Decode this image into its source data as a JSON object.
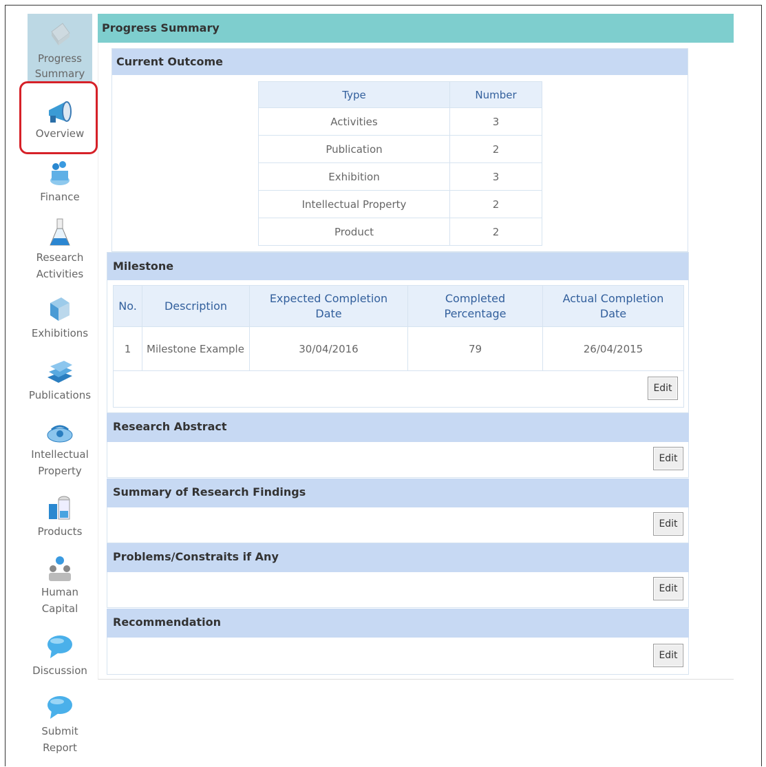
{
  "sidebar": {
    "items": [
      {
        "label": "Progress Summary",
        "icon": "document-icon"
      },
      {
        "label": "Overview",
        "icon": "megaphone-icon"
      },
      {
        "label": "Finance",
        "icon": "money-icon"
      },
      {
        "label": "Research Activities",
        "icon": "flask-icon"
      },
      {
        "label": "Exhibitions",
        "icon": "exhibition-icon"
      },
      {
        "label": "Publications",
        "icon": "books-icon"
      },
      {
        "label": "Intellectual Property",
        "icon": "ip-icon"
      },
      {
        "label": "Products",
        "icon": "products-icon"
      },
      {
        "label": "Human Capital",
        "icon": "people-icon"
      },
      {
        "label": "Discussion",
        "icon": "chat-bubble-icon"
      },
      {
        "label": "Submit Report",
        "icon": "chat-bubble-icon"
      }
    ]
  },
  "page_title": "Progress Summary",
  "current_outcome": {
    "heading": "Current Outcome",
    "columns": [
      "Type",
      "Number"
    ],
    "rows": [
      [
        "Activities",
        "3"
      ],
      [
        "Publication",
        "2"
      ],
      [
        "Exhibition",
        "3"
      ],
      [
        "Intellectual Property",
        "2"
      ],
      [
        "Product",
        "2"
      ]
    ]
  },
  "milestone": {
    "heading": "Milestone",
    "columns": [
      "No.",
      "Description",
      "Expected Completion Date",
      "Completed Percentage",
      "Actual Completion Date"
    ],
    "rows": [
      [
        "1",
        "Milestone Example",
        "30/04/2016",
        "79",
        "26/04/2015"
      ]
    ],
    "edit_label": "Edit"
  },
  "sections": [
    {
      "heading": "Research Abstract",
      "edit_label": "Edit"
    },
    {
      "heading": "Summary of Research Findings",
      "edit_label": "Edit"
    },
    {
      "heading": "Problems/Constraits if Any",
      "edit_label": "Edit"
    },
    {
      "heading": "Recommendation",
      "edit_label": "Edit"
    }
  ],
  "colors": {
    "title_bar": "#7ecece",
    "section_header": "#c7d9f3",
    "table_header_text": "#325f9c",
    "highlight": "#d62128"
  }
}
